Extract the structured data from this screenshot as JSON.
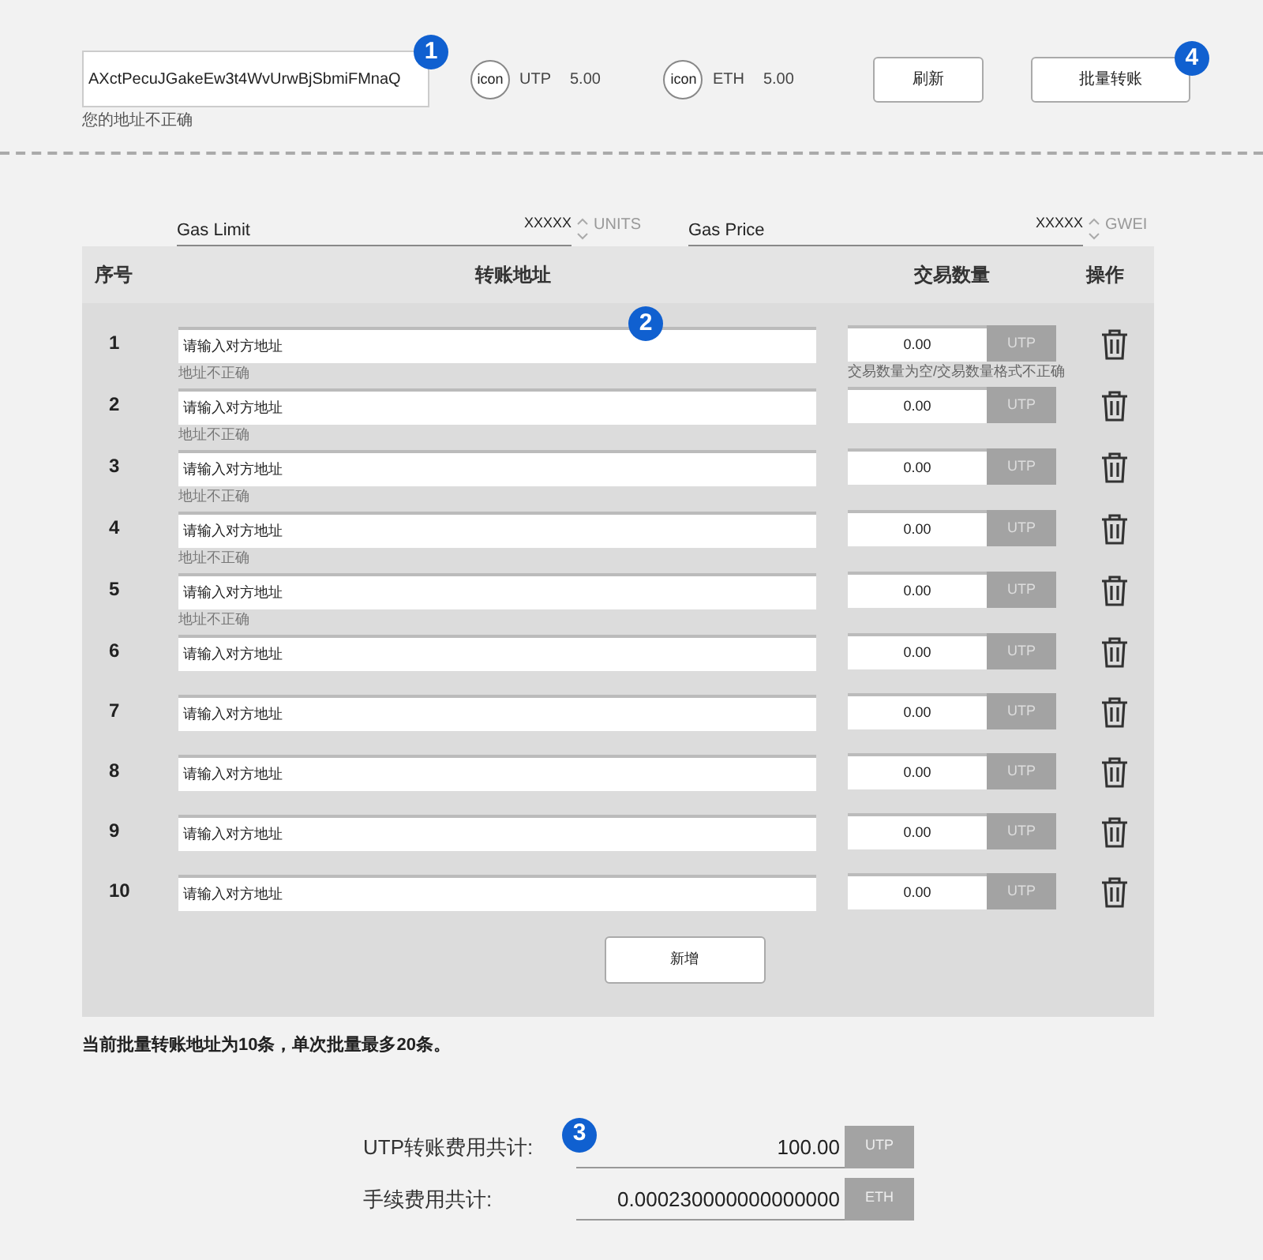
{
  "wallet": {
    "address": "AXctPecuJGakeEw3t4WvUrwBjSbmiFMnaQ",
    "error": "您的地址不正确",
    "marker": "1"
  },
  "balances": [
    {
      "icon_label": "icon",
      "currency": "UTP",
      "amount": "5.00"
    },
    {
      "icon_label": "icon",
      "currency": "ETH",
      "amount": "5.00"
    }
  ],
  "buttons": [
    {
      "label": "刷新"
    },
    {
      "label": "批量转账",
      "marker": "4"
    }
  ],
  "gas": [
    {
      "label": "Gas Limit",
      "value": "XXXXX",
      "unit": "UNITS"
    },
    {
      "label": "Gas Price",
      "value": "XXXXX",
      "unit": "GWEI"
    }
  ],
  "table": {
    "marker": "2",
    "columns": [
      "序号",
      "转账地址",
      "交易数量",
      "操作"
    ],
    "rows": [
      {
        "index": "1",
        "placeholder": "请输入对方地址",
        "address_error": "地址不正确",
        "amount": "0.00",
        "unit": "UTP",
        "amount_error": "交易数量为空/交易数量格式不正确"
      },
      {
        "index": "2",
        "placeholder": "请输入对方地址",
        "address_error": "地址不正确",
        "amount": "0.00",
        "unit": "UTP"
      },
      {
        "index": "3",
        "placeholder": "请输入对方地址",
        "address_error": "地址不正确",
        "amount": "0.00",
        "unit": "UTP"
      },
      {
        "index": "4",
        "placeholder": "请输入对方地址",
        "address_error": "地址不正确",
        "amount": "0.00",
        "unit": "UTP"
      },
      {
        "index": "5",
        "placeholder": "请输入对方地址",
        "address_error": "地址不正确",
        "amount": "0.00",
        "unit": "UTP"
      },
      {
        "index": "6",
        "placeholder": "请输入对方地址",
        "amount": "0.00",
        "unit": "UTP"
      },
      {
        "index": "7",
        "placeholder": "请输入对方地址",
        "amount": "0.00",
        "unit": "UTP"
      },
      {
        "index": "8",
        "placeholder": "请输入对方地址",
        "amount": "0.00",
        "unit": "UTP"
      },
      {
        "index": "9",
        "placeholder": "请输入对方地址",
        "amount": "0.00",
        "unit": "UTP"
      },
      {
        "index": "10",
        "placeholder": "请输入对方地址",
        "amount": "0.00",
        "unit": "UTP"
      }
    ],
    "add_button": "新增"
  },
  "note": "当前批量转账地址为10条，单次批量最多20条。",
  "totals": {
    "marker": "3",
    "items": [
      {
        "label": "UTP转账费用共计:",
        "value": "100.00",
        "unit": "UTP"
      },
      {
        "label": "手续费用共计:",
        "value": "0.000230000000000000",
        "unit": "ETH"
      }
    ]
  }
}
